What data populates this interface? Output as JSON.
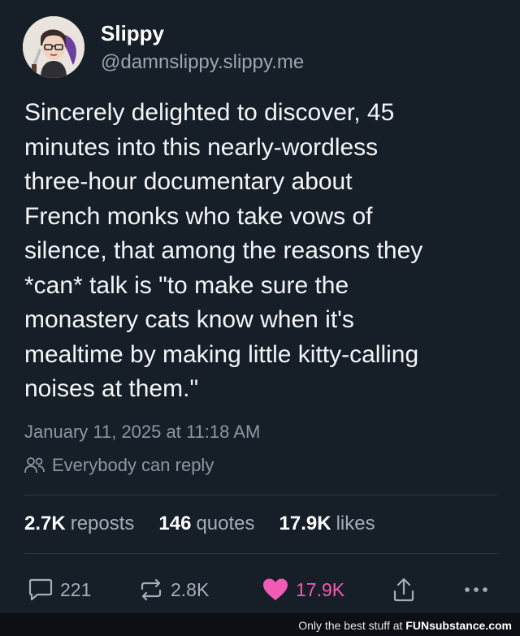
{
  "author": {
    "display_name": "Slippy",
    "handle": "@damnslippy.slippy.me"
  },
  "post": {
    "text": "Sincerely delighted to discover, 45\nminutes into this nearly-wordless\nthree-hour documentary about\nFrench monks who take vows of\nsilence, that among the reasons they\n*can* talk is \"to make sure the\nmonastery cats know when it's\nmealtime by making little kitty-calling\nnoises at them.\"",
    "timestamp": "January 11, 2025 at 11:18 AM",
    "reply_setting": "Everybody can reply"
  },
  "stats": {
    "reposts_count": "2.7K",
    "reposts_label": "reposts",
    "quotes_count": "146",
    "quotes_label": "quotes",
    "likes_count": "17.9K",
    "likes_label": "likes"
  },
  "actions": {
    "reply_count": "221",
    "repost_count": "2.8K",
    "like_count": "17.9K",
    "reply_icon": "comment-icon",
    "repost_icon": "repost-icon",
    "like_icon": "heart-icon",
    "share_icon": "share-icon",
    "more_icon": "more-icon"
  },
  "watermark": {
    "prefix": "Only the best stuff at ",
    "brand": "FUNsubstance.com"
  },
  "colors": {
    "background": "#161e27",
    "like_accent": "#f15bb5",
    "muted_text": "#8c97a4"
  }
}
